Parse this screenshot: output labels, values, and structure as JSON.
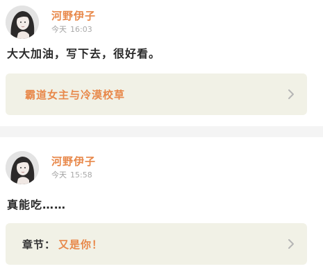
{
  "comments": [
    {
      "username": "河野伊子",
      "day": "今天",
      "time": "16:03",
      "text": "大大加油，写下去，很好看。",
      "chapter_prefix": "",
      "chapter_title": "霸道女主与冷漠校草"
    },
    {
      "username": "河野伊子",
      "day": "今天",
      "time": "15:58",
      "text": "真能吃……",
      "chapter_prefix": "章节：",
      "chapter_title": "又是你！"
    }
  ],
  "icons": {
    "avatar": "avatar-photo",
    "chevron": "chevron-right-icon"
  },
  "colors": {
    "accent": "#e8884a",
    "card_bg": "#ffffff",
    "chapter_bg": "#f1f1e6",
    "page_bg": "#f4f4f4"
  }
}
